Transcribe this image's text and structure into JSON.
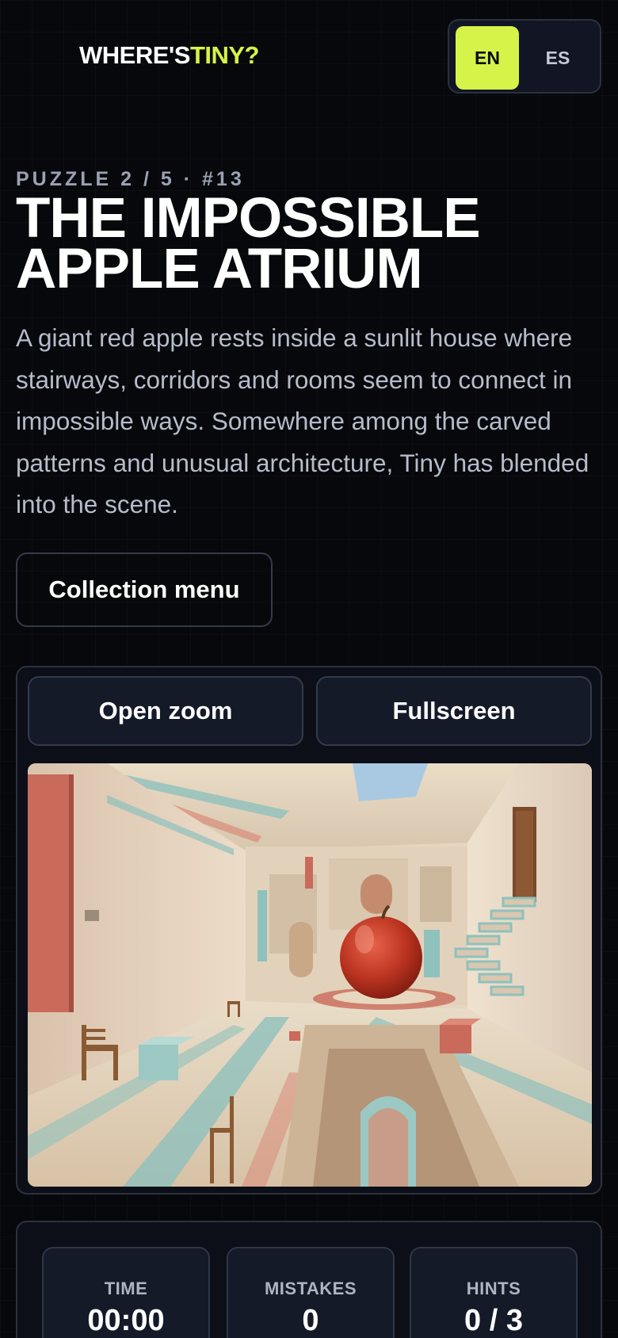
{
  "header": {
    "logo_prefix": "WHERE'S",
    "logo_accent": "TINY?",
    "languages": [
      {
        "code": "EN",
        "active": true
      },
      {
        "code": "ES",
        "active": false
      }
    ]
  },
  "puzzle": {
    "kicker": "PUZZLE 2 / 5 · #13",
    "title": "THE IMPOSSIBLE APPLE ATRIUM",
    "description": "A giant red apple rests inside a sunlit house where stairways, corridors and rooms seem to connect in impossible ways. Somewhere among the carved patterns and unusual architecture, Tiny has blended into the scene."
  },
  "actions": {
    "collection_menu": "Collection menu",
    "open_zoom": "Open zoom",
    "fullscreen": "Fullscreen"
  },
  "stats": [
    {
      "label": "TIME",
      "value": "00:00"
    },
    {
      "label": "MISTAKES",
      "value": "0"
    },
    {
      "label": "HINTS",
      "value": "0 / 3"
    }
  ],
  "colors": {
    "accent": "#d6f349",
    "background": "#07080b",
    "panel": "#141a28"
  }
}
